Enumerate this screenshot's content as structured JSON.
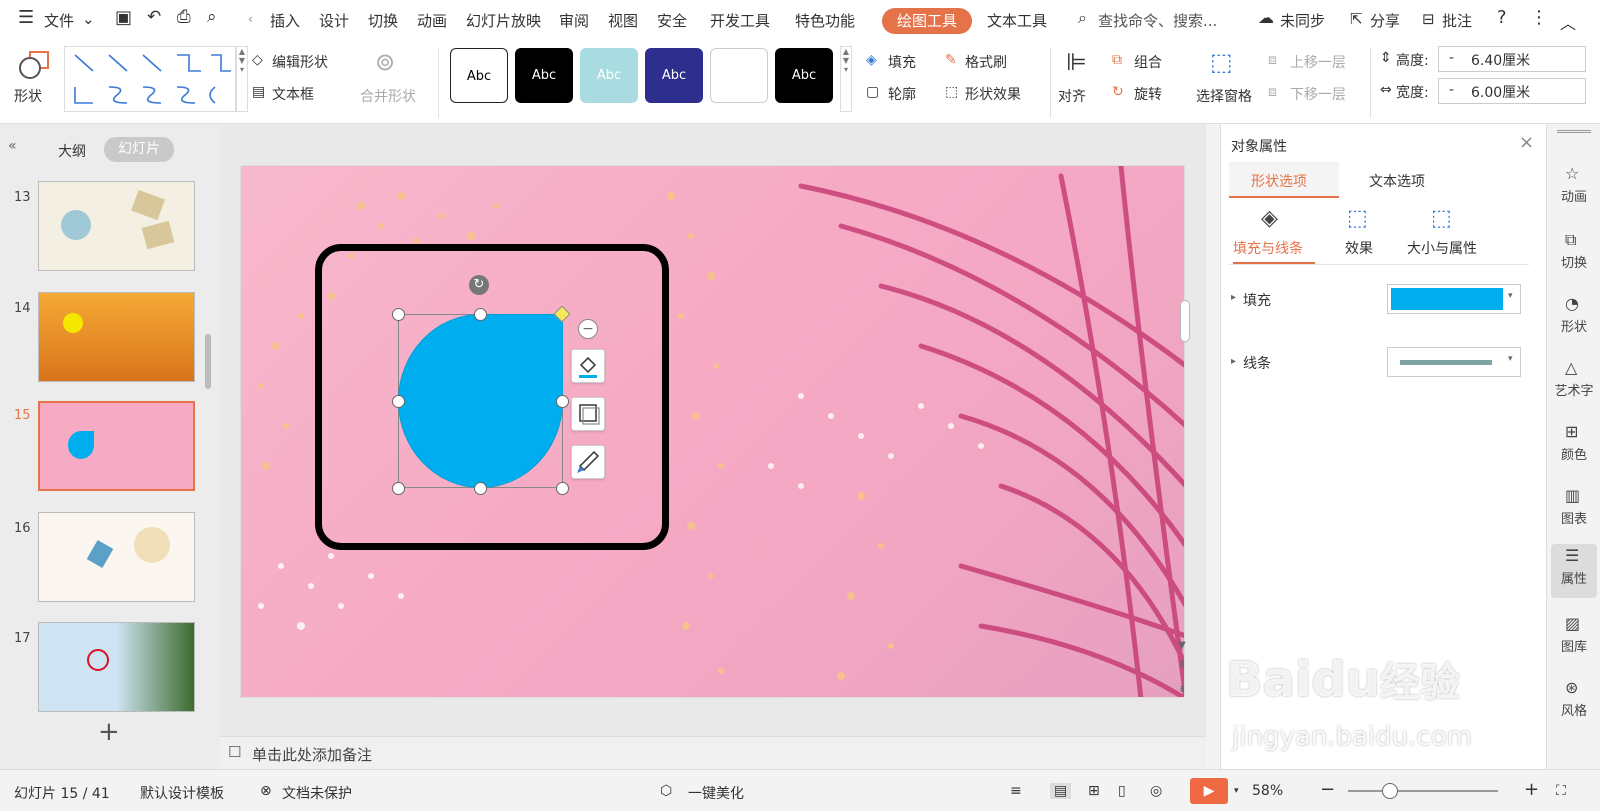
{
  "menu": {
    "file": "文件",
    "tabs": [
      "插入",
      "设计",
      "切换",
      "动画",
      "幻灯片放映",
      "审阅",
      "视图",
      "安全",
      "开发工具",
      "特色功能"
    ],
    "active_tab": "绘图工具",
    "text_tool": "文本工具",
    "search": "查找命令、搜索...",
    "sync": "未同步",
    "share": "分享",
    "comment": "批注"
  },
  "ribbon": {
    "shape": "形状",
    "edit_shape": "编辑形状",
    "textbox": "文本框",
    "merge_shape": "合并形状",
    "style_label": "Abc",
    "fill": "填充",
    "format_painter": "格式刷",
    "outline": "轮廓",
    "shape_effect": "形状效果",
    "align": "对齐",
    "group": "组合",
    "rotate": "旋转",
    "selection_pane": "选择窗格",
    "bring_forward": "上移一层",
    "send_backward": "下移一层",
    "height_label": "高度:",
    "height_value": "6.40厘米",
    "width_label": "宽度:",
    "width_value": "6.00厘米",
    "minus": "-"
  },
  "left": {
    "tab_outline": "大纲",
    "tab_slides": "幻灯片",
    "slides": [
      {
        "num": "13"
      },
      {
        "num": "14"
      },
      {
        "num": "15"
      },
      {
        "num": "16"
      },
      {
        "num": "17"
      }
    ],
    "add": "+"
  },
  "notes": "单击此处添加备注",
  "panel": {
    "title": "对象属性",
    "tab_shape": "形状选项",
    "tab_text": "文本选项",
    "fill_line": "填充与线条",
    "effect": "效果",
    "size_prop": "大小与属性",
    "fill": "填充",
    "line": "线条",
    "fill_color": "#00aeef",
    "line_color": "#7fa3a3"
  },
  "sidebar": [
    "动画",
    "切换",
    "形状",
    "艺术字",
    "颜色",
    "图表",
    "属性",
    "图库",
    "风格"
  ],
  "status": {
    "slide": "幻灯片 15 / 41",
    "template": "默认设计模板",
    "protect": "文档未保护",
    "beautify": "一键美化",
    "zoom": "58%"
  },
  "watermark": {
    "brand": "Baidu",
    "brand_cn": "经验",
    "url": "jingyan.baidu.com"
  },
  "colors": {
    "accent": "#e5734a",
    "shape_fill": "#00aeef",
    "slide_bg": "#f6aac4"
  }
}
